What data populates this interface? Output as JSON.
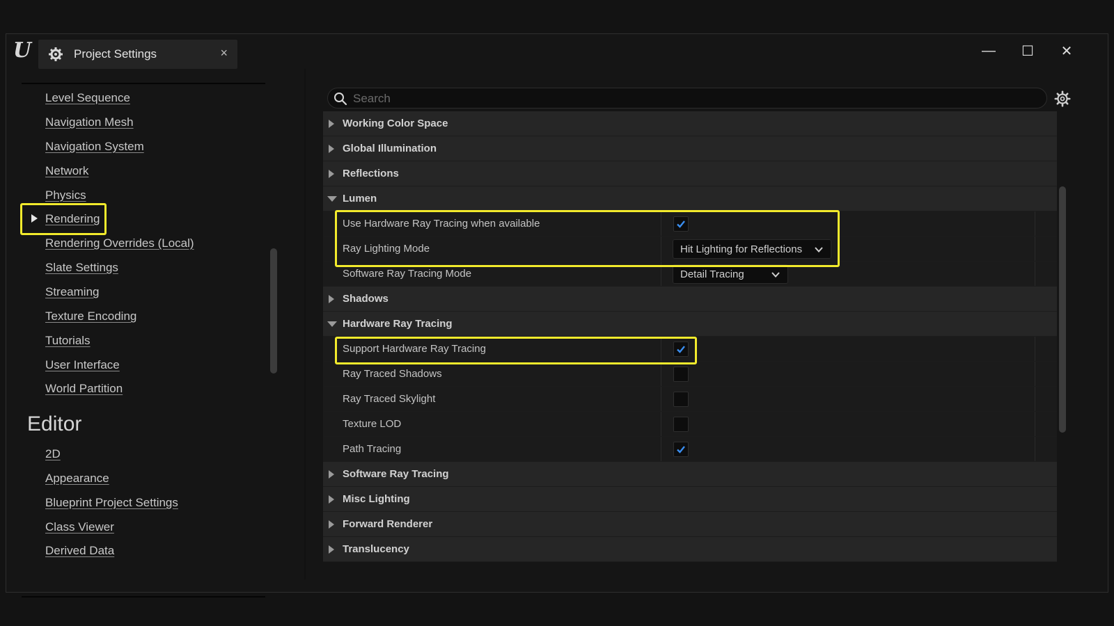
{
  "window": {
    "tab_title": "Project Settings",
    "tab_close": "×",
    "logo_letter": "U",
    "controls": {
      "minimize": "—",
      "maximize": "☐",
      "close": "✕"
    }
  },
  "sidebar": {
    "items": [
      "Level Sequence",
      "Navigation Mesh",
      "Navigation System",
      "Network",
      "Physics",
      "Rendering",
      "Rendering Overrides (Local)",
      "Slate Settings",
      "Streaming",
      "Texture Encoding",
      "Tutorials",
      "User Interface",
      "World Partition"
    ],
    "selected": "Rendering",
    "editor_heading": "Editor",
    "editor_items": [
      "2D",
      "Appearance",
      "Blueprint Project Settings",
      "Class Viewer",
      "Derived Data"
    ]
  },
  "search": {
    "placeholder": "Search",
    "value": ""
  },
  "rows": [
    {
      "type": "section",
      "label": "Working Color Space",
      "expanded": false
    },
    {
      "type": "section",
      "label": "Global Illumination",
      "expanded": false
    },
    {
      "type": "section",
      "label": "Reflections",
      "expanded": false
    },
    {
      "type": "section",
      "label": "Lumen",
      "expanded": true
    },
    {
      "type": "checkbox",
      "label": "Use Hardware Ray Tracing when available",
      "checked": true
    },
    {
      "type": "dropdown",
      "label": "Ray Lighting Mode",
      "value": "Hit Lighting for Reflections"
    },
    {
      "type": "dropdown",
      "label": "Software Ray Tracing Mode",
      "value": "Detail Tracing"
    },
    {
      "type": "section",
      "label": "Shadows",
      "expanded": false
    },
    {
      "type": "section",
      "label": "Hardware Ray Tracing",
      "expanded": true
    },
    {
      "type": "checkbox",
      "label": "Support Hardware Ray Tracing",
      "checked": true
    },
    {
      "type": "checkbox",
      "label": "Ray Traced Shadows",
      "checked": false
    },
    {
      "type": "checkbox",
      "label": "Ray Traced Skylight",
      "checked": false
    },
    {
      "type": "checkbox",
      "label": "Texture LOD",
      "checked": false
    },
    {
      "type": "checkbox",
      "label": "Path Tracing",
      "checked": true
    },
    {
      "type": "section",
      "label": "Software Ray Tracing",
      "expanded": false
    },
    {
      "type": "section",
      "label": "Misc Lighting",
      "expanded": false
    },
    {
      "type": "section",
      "label": "Forward Renderer",
      "expanded": false
    },
    {
      "type": "section",
      "label": "Translucency",
      "expanded": false
    }
  ],
  "colors": {
    "highlight": "#f2ea2c",
    "checkmark": "#3a8ef0",
    "section_bg": "#262626",
    "property_bg": "#1b1b1b"
  }
}
